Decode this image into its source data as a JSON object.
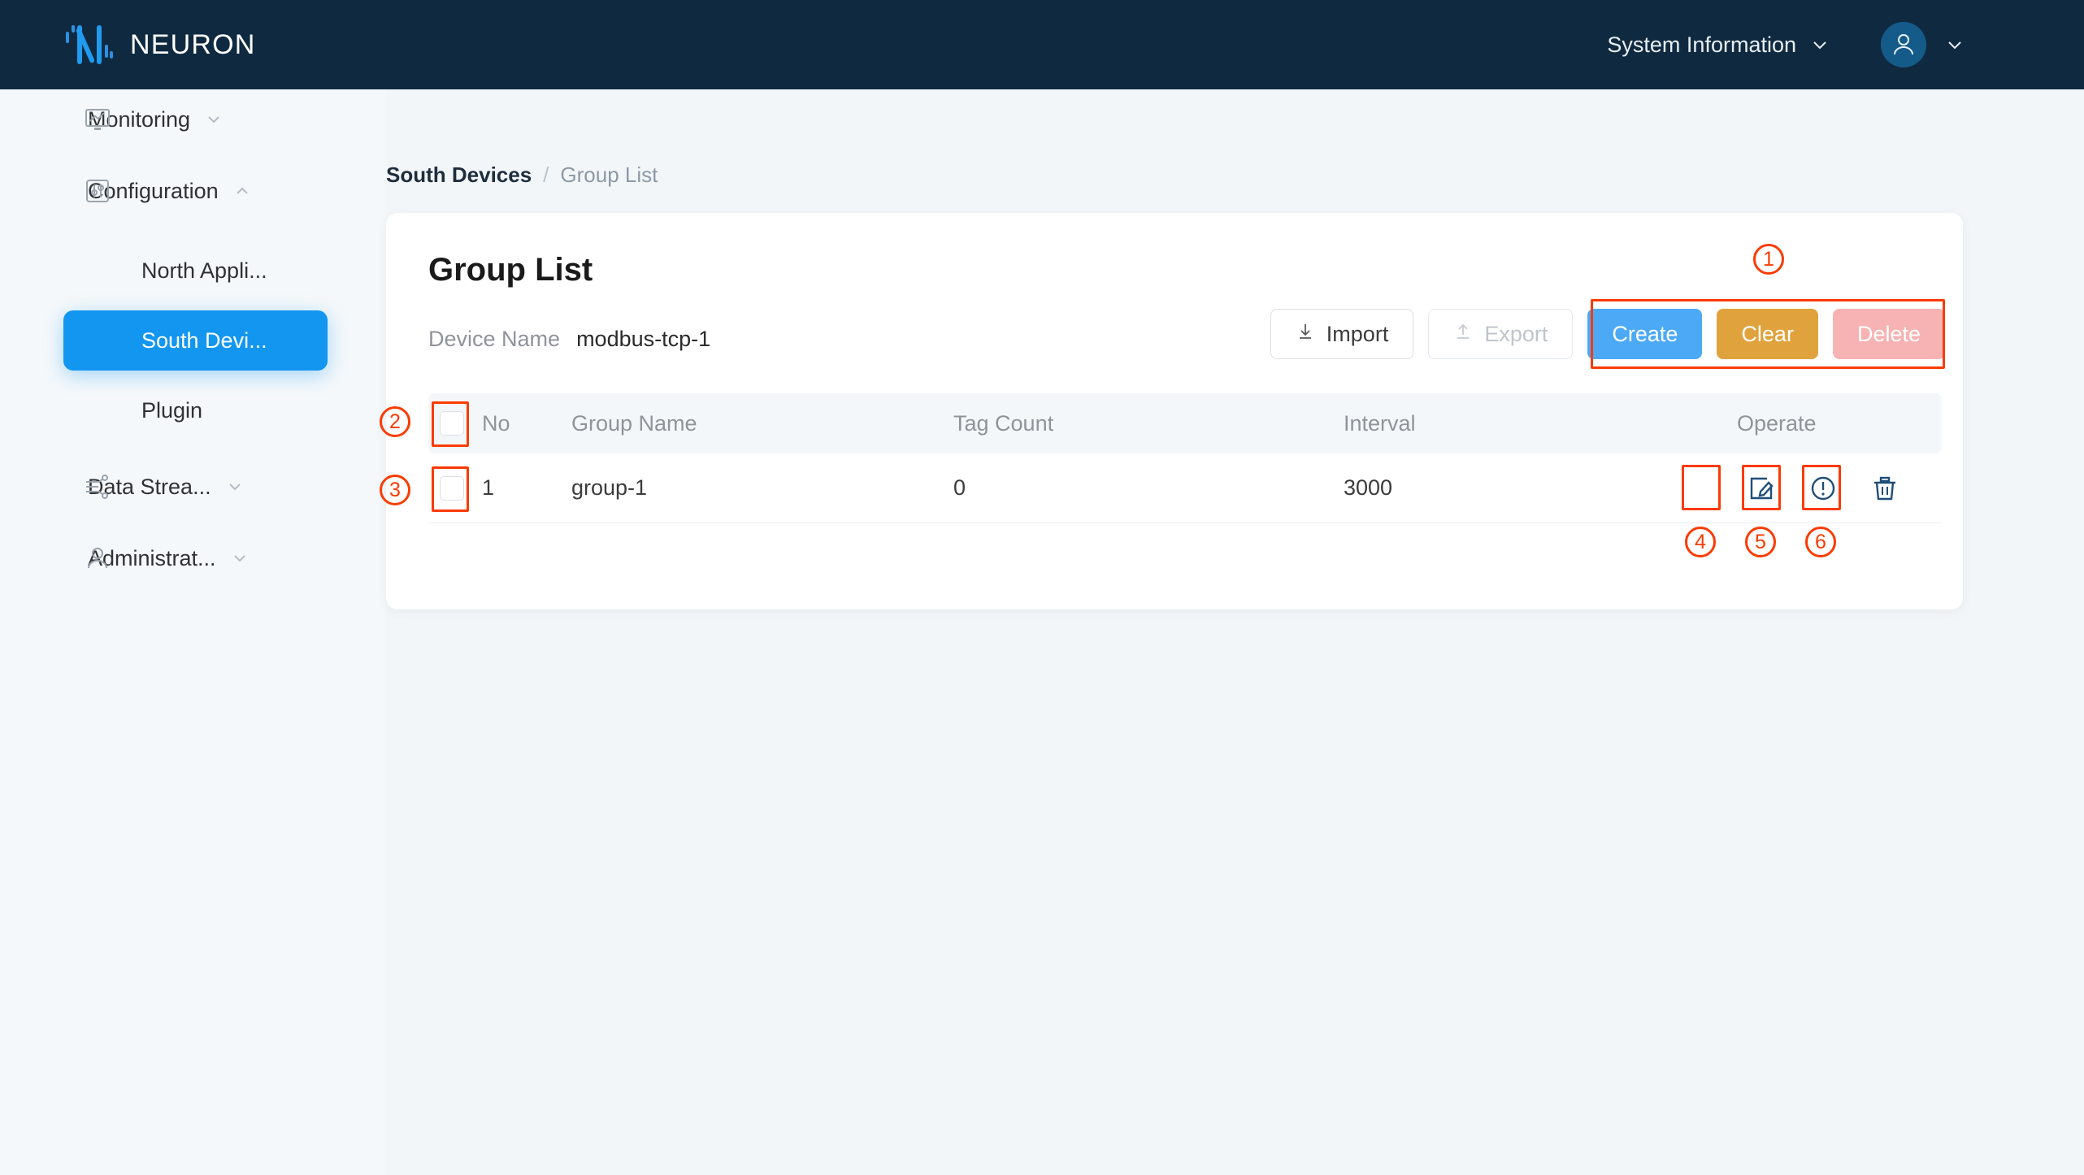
{
  "app": {
    "brand_name": "NEURON",
    "brand_icon": "neuron-logo-icon"
  },
  "topbar": {
    "system_information_label": "System Information",
    "system_information_chevron": "chevron-down-icon",
    "avatar_icon": "user-avatar-icon",
    "avatar_chevron": "chevron-down-icon"
  },
  "sidebar": {
    "items": [
      {
        "label": "Monitoring",
        "icon": "monitor-icon",
        "arrow": "chevron-down-icon",
        "active": false
      },
      {
        "label": "Configuration",
        "icon": "sliders-icon",
        "arrow": "chevron-up-icon",
        "active": false
      },
      {
        "label": "North Appli...",
        "icon": "",
        "arrow": "",
        "active": false
      },
      {
        "label": "South Devi...",
        "icon": "",
        "arrow": "",
        "active": true
      },
      {
        "label": "Plugin",
        "icon": "",
        "arrow": "",
        "active": false
      },
      {
        "label": "Data Strea...",
        "icon": "data-stream-icon",
        "arrow": "chevron-down-icon",
        "active": false
      },
      {
        "label": "Administrat...",
        "icon": "user-icon",
        "arrow": "chevron-down-icon",
        "active": false
      }
    ]
  },
  "breadcrumb": {
    "root": "South Devices",
    "separator": "/",
    "current": "Group List"
  },
  "card": {
    "title": "Group List",
    "device_name_label": "Device Name",
    "device_name_value": "modbus-tcp-1"
  },
  "toolbar": {
    "import_label": "Import",
    "import_icon": "download-icon",
    "export_label": "Export",
    "export_icon": "upload-icon",
    "create_label": "Create",
    "clear_label": "Clear",
    "delete_label": "Delete",
    "colors": {
      "create": "#4ba9f5",
      "clear": "#e0a23c",
      "delete": "#f7b3b3",
      "annotation": "#fb3b00"
    }
  },
  "table": {
    "headers": {
      "no": "No",
      "group_name": "Group Name",
      "tag_count": "Tag Count",
      "interval": "Interval",
      "operate": "Operate"
    },
    "rows": [
      {
        "no": "1",
        "group_name": "group-1",
        "tag_count": "0",
        "interval": "3000",
        "operations": [
          {
            "icon": "edit-icon"
          },
          {
            "icon": "alert-circle-icon"
          },
          {
            "icon": "trash-icon"
          }
        ]
      }
    ]
  },
  "annotations": [
    {
      "number": "1",
      "target": "toolbar-button-group"
    },
    {
      "number": "2",
      "target": "header-select-all-checkbox"
    },
    {
      "number": "3",
      "target": "row-checkbox"
    },
    {
      "number": "4",
      "target": "edit-icon"
    },
    {
      "number": "5",
      "target": "alert-circle-icon"
    },
    {
      "number": "6",
      "target": "trash-icon"
    }
  ]
}
